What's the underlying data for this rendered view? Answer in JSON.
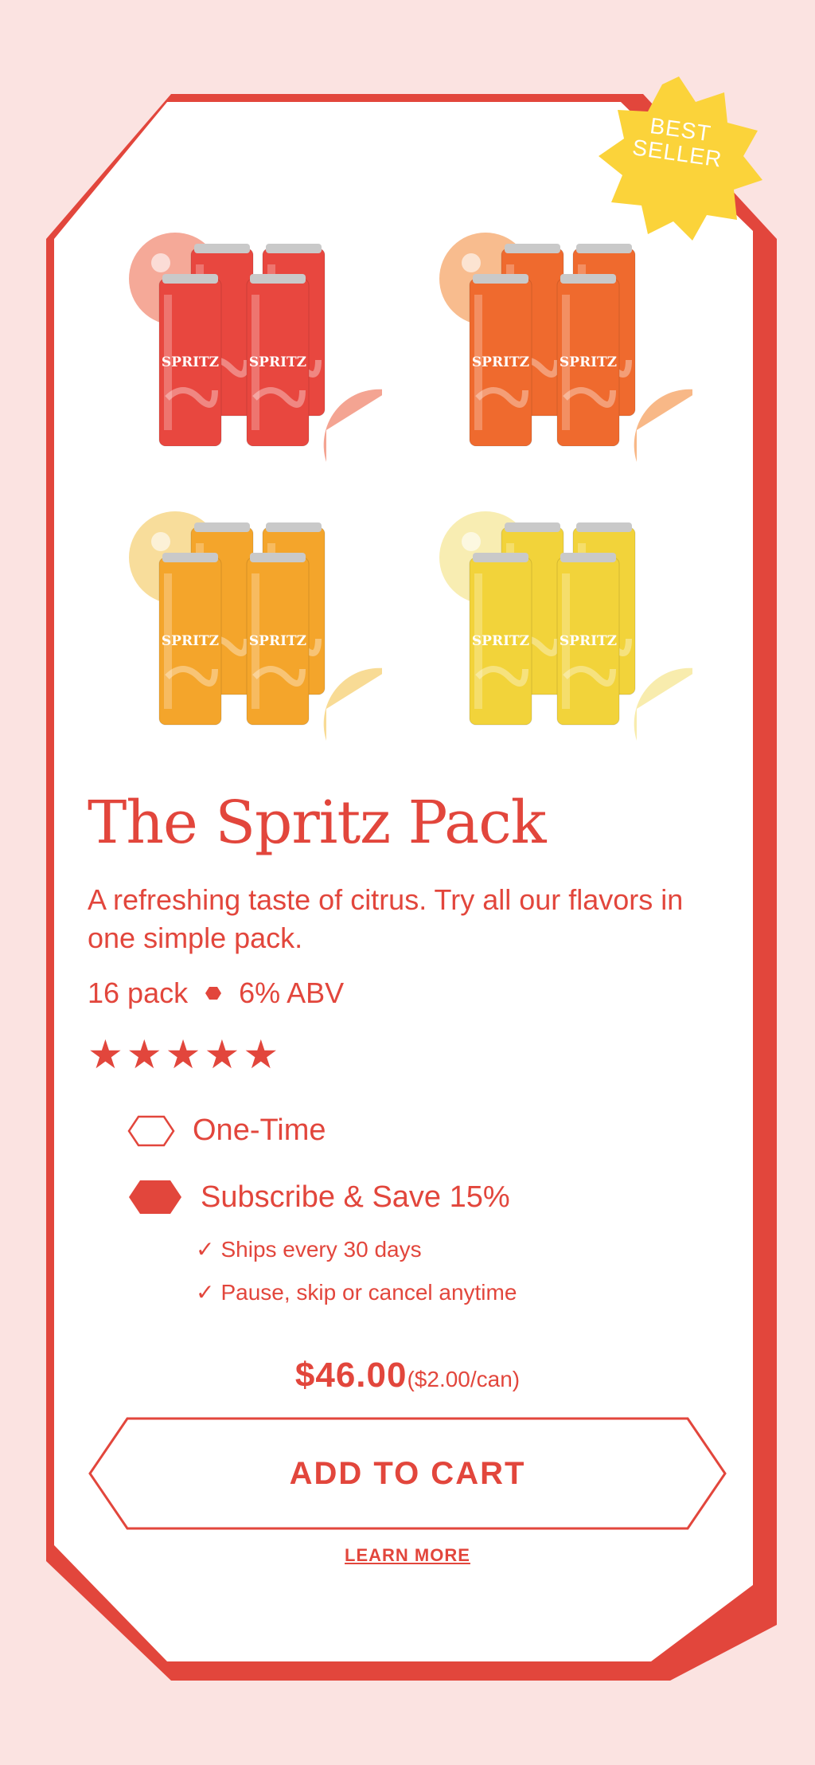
{
  "badge": {
    "line1": "BEST",
    "line2": "SELLER"
  },
  "products": [
    {
      "name": "grapefruit-pack-image",
      "can_label": "SPRITZ",
      "can_color": "#e8473f",
      "fruit_color": "#f39a86"
    },
    {
      "name": "orange-pack-image",
      "can_label": "SPRITZ",
      "can_color": "#ef6a2e",
      "fruit_color": "#f7b07a"
    },
    {
      "name": "pineapple-pack-image",
      "can_label": "SPRITZ",
      "can_color": "#f4a52b",
      "fruit_color": "#f7d78a"
    },
    {
      "name": "lemon-pack-image",
      "can_label": "SPRITZ",
      "can_color": "#f2d33a",
      "fruit_color": "#f7eaa4"
    }
  ],
  "title": "The Spritz Pack",
  "description": "A refreshing taste of citrus. Try all our flavors in one simple pack.",
  "meta": {
    "pack": "16 pack",
    "abv": "6% ABV"
  },
  "rating": {
    "stars": 5,
    "max": 5
  },
  "options": {
    "one_time": "One-Time",
    "subscribe": "Subscribe & Save 15%",
    "selected": "subscribe",
    "perks": [
      "Ships every 30 days",
      "Pause, skip or cancel anytime"
    ]
  },
  "price": {
    "amount": "$46.00",
    "per_unit": "($2.00/can)"
  },
  "cta": {
    "add_to_cart": "ADD TO CART",
    "learn_more": "LEARN MORE"
  },
  "colors": {
    "accent": "#e2463c",
    "background": "#fbe3e1",
    "badge": "#fbd33a"
  }
}
